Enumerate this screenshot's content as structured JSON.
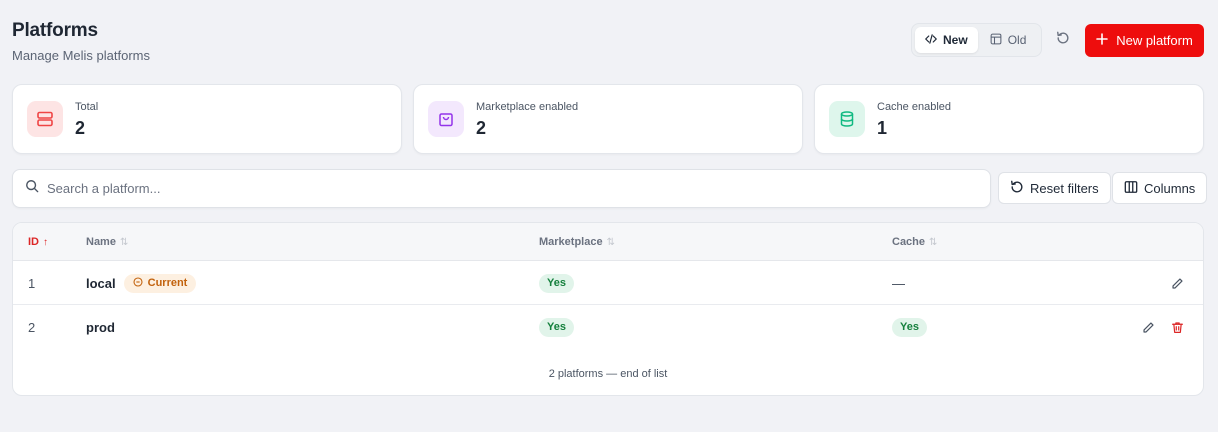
{
  "header": {
    "title": "Platforms",
    "subtitle": "Manage Melis platforms"
  },
  "view_toggle": {
    "new_label": "New",
    "old_label": "Old",
    "active": "New"
  },
  "toolbar": {
    "new_platform_label": "New platform",
    "reset_filters_label": "Reset filters",
    "columns_label": "Columns"
  },
  "stats": [
    {
      "label": "Total",
      "value": "2",
      "icon": "server-icon",
      "color": "#ef4444"
    },
    {
      "label": "Marketplace enabled",
      "value": "2",
      "icon": "shopping-bag-icon",
      "color": "#9333ea"
    },
    {
      "label": "Cache enabled",
      "value": "1",
      "icon": "database-icon",
      "color": "#10b981"
    }
  ],
  "search": {
    "placeholder": "Search a platform...",
    "value": ""
  },
  "table": {
    "columns": [
      {
        "label": "ID",
        "sort": "ascending"
      },
      {
        "label": "Name",
        "sort": "none"
      },
      {
        "label": "Marketplace",
        "sort": "none"
      },
      {
        "label": "Cache",
        "sort": "none"
      }
    ],
    "rows": [
      {
        "id": "1",
        "name": "local",
        "badge": "Current",
        "marketplace": "Yes",
        "cache": "—",
        "actions": [
          "edit"
        ]
      },
      {
        "id": "2",
        "name": "prod",
        "badge": "",
        "marketplace": "Yes",
        "cache": "Yes",
        "actions": [
          "edit",
          "delete"
        ]
      }
    ],
    "footer": "2 platforms — end of list"
  },
  "colors": {
    "accent": "#ee0d0d",
    "background": "#f1f2f6",
    "success_bg": "#e1f4ea",
    "success_text": "#15803d",
    "warning_bg": "#fdf0e1",
    "warning_text": "#c2620d"
  }
}
